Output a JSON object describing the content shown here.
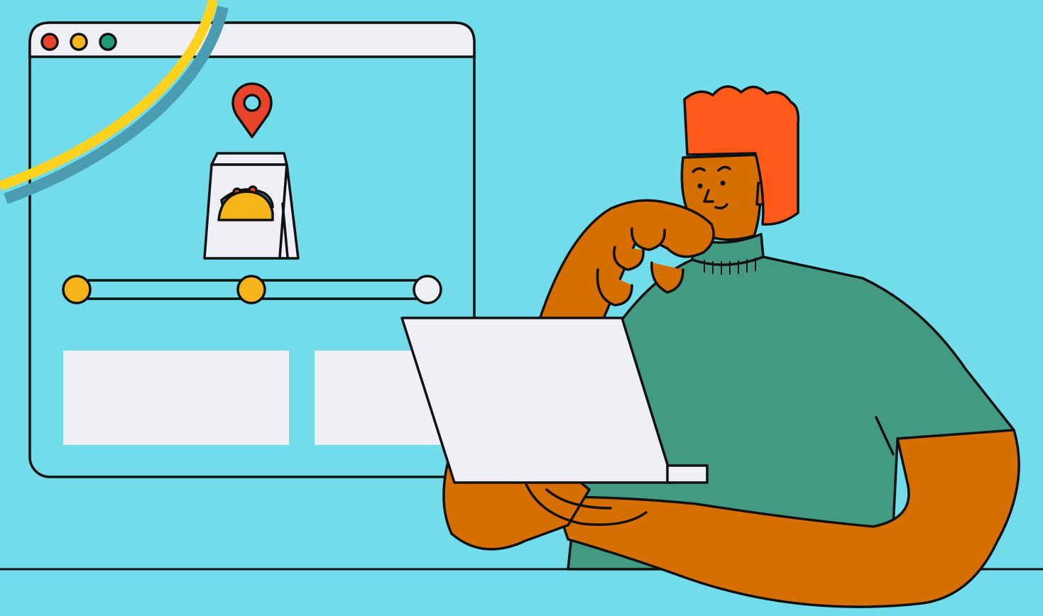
{
  "illustration": {
    "background_color": "#72DCEA",
    "browser_window": {
      "chrome_color": "#EEF0F6",
      "window_controls": [
        {
          "name": "close",
          "color": "#E8432B"
        },
        {
          "name": "minimize",
          "color": "#F4B41A"
        },
        {
          "name": "maximize",
          "color": "#1F9A77"
        }
      ],
      "icons": [
        "location-pin-icon",
        "takeout-bag-icon",
        "taco-icon"
      ],
      "order_progress": {
        "steps_total": 3,
        "steps_completed": 2,
        "active_color": "#F4B41A",
        "inactive_color": "#EEF0F6"
      },
      "content_cards": 2
    },
    "colors": {
      "pin": "#E8432B",
      "hair": "#FF5A1A",
      "skin": "#D66E00",
      "shirt": "#429B80",
      "laptop": "#EEF0F6",
      "yellow_arc": "#FFD21E",
      "arc_shadow": "#4A9DB0",
      "outline": "#111111"
    }
  }
}
